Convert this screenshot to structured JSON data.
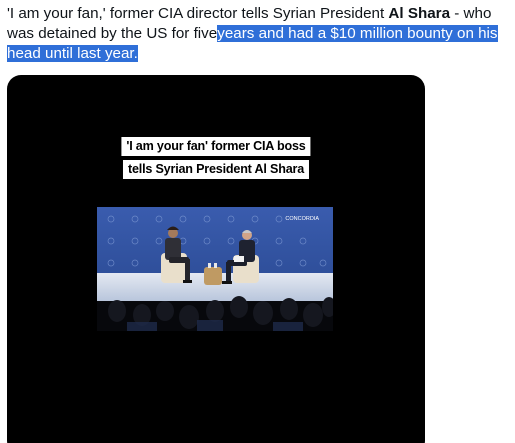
{
  "post": {
    "text_part1": "'I am your fan,' former CIA director tells Syrian President ",
    "text_bold": "Al Shara",
    "text_part2": " - who was detained by the US for five",
    "text_highlighted": "years and had a $10 million bounty on his head until last year."
  },
  "video": {
    "caption_line1": "'I am your fan' former CIA boss",
    "caption_line2": "tells Syrian President Al Shara",
    "stage_logo": "CONCORDIA"
  },
  "colors": {
    "selection": "#2f6fd8",
    "stage_backdrop": "#2c4c9a",
    "stage_floor": "#cfd8e8"
  }
}
